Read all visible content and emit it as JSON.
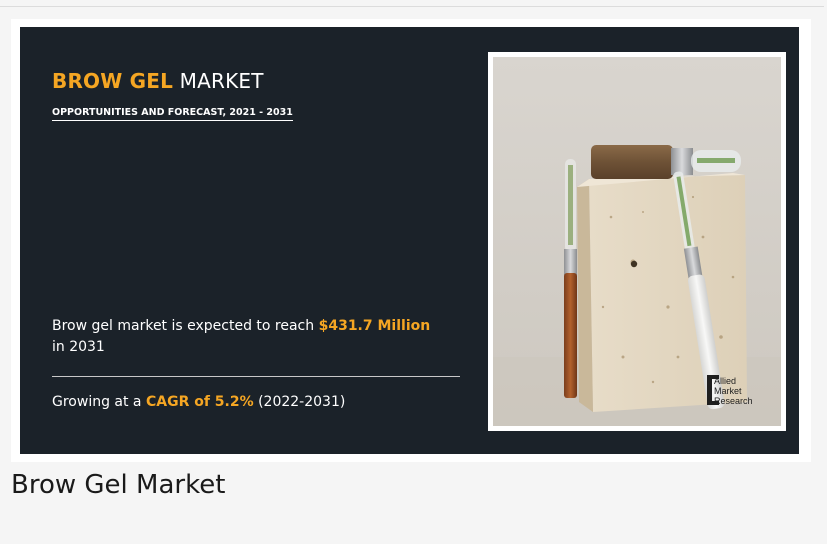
{
  "banner": {
    "title_accent": "BROW GEL",
    "title_rest": " MARKET",
    "subtitle": "OPPORTUNITIES AND FORECAST, 2021 - 2031",
    "reach_prefix": "Brow gel market is expected to reach ",
    "reach_value": "$431.7 Million",
    "reach_suffix": " in 2031",
    "cagr_prefix": "Growing at a ",
    "cagr_value": "CAGR of 5.2%",
    "cagr_suffix": " (2022-2031)",
    "logo_lines": [
      "Allied",
      "Market",
      "Research"
    ]
  },
  "caption": "Brow Gel Market",
  "colors": {
    "banner_bg": "#1b2229",
    "accent": "#f5a623",
    "page_bg": "#f5f5f5"
  }
}
